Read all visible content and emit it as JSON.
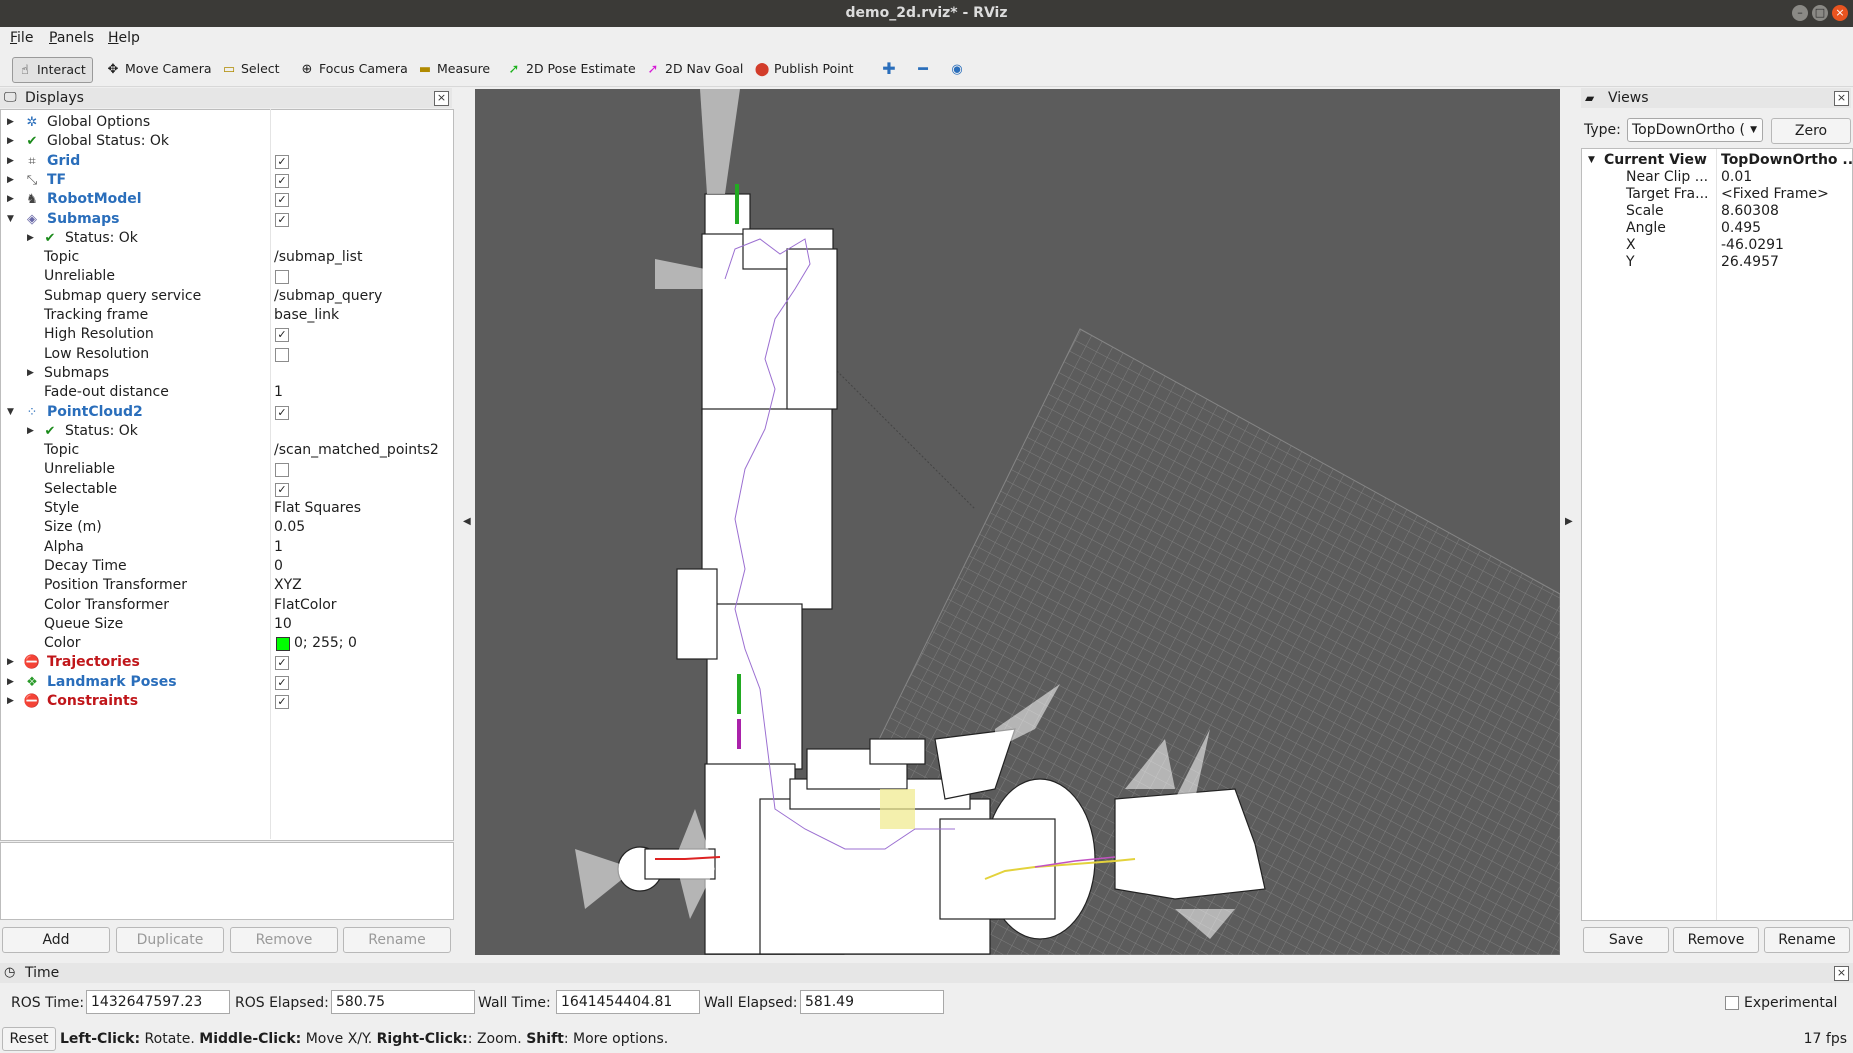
{
  "window": {
    "title": "demo_2d.rviz* - RViz"
  },
  "menu": [
    {
      "pre": "",
      "ul": "F",
      "post": "ile"
    },
    {
      "pre": "",
      "ul": "P",
      "post": "anels"
    },
    {
      "pre": "",
      "ul": "H",
      "post": "elp"
    }
  ],
  "toolbar": {
    "interact": "Interact",
    "move_camera": "Move Camera",
    "select": "Select",
    "focus_camera": "Focus Camera",
    "measure": "Measure",
    "pose_estimate": "2D Pose Estimate",
    "nav_goal": "2D Nav Goal",
    "publish_point": "Publish Point"
  },
  "displays": {
    "title": "Displays",
    "rows": [
      {
        "name": "Global Options",
        "value": ""
      },
      {
        "name": "Global Status: Ok",
        "value": ""
      },
      {
        "name": "Grid",
        "value": ""
      },
      {
        "name": "TF",
        "value": ""
      },
      {
        "name": "RobotModel",
        "value": ""
      },
      {
        "name": "Submaps",
        "value": ""
      },
      {
        "name": "Status: Ok",
        "value": ""
      },
      {
        "name": "Topic",
        "value": "/submap_list"
      },
      {
        "name": "Unreliable",
        "value": ""
      },
      {
        "name": "Submap query service",
        "value": "/submap_query"
      },
      {
        "name": "Tracking frame",
        "value": "base_link"
      },
      {
        "name": "High Resolution",
        "value": ""
      },
      {
        "name": "Low Resolution",
        "value": ""
      },
      {
        "name": "Submaps",
        "value": ""
      },
      {
        "name": "Fade-out distance",
        "value": "1"
      },
      {
        "name": "PointCloud2",
        "value": ""
      },
      {
        "name": "Status: Ok",
        "value": ""
      },
      {
        "name": "Topic",
        "value": "/scan_matched_points2"
      },
      {
        "name": "Unreliable",
        "value": ""
      },
      {
        "name": "Selectable",
        "value": ""
      },
      {
        "name": "Style",
        "value": "Flat Squares"
      },
      {
        "name": "Size (m)",
        "value": "0.05"
      },
      {
        "name": "Alpha",
        "value": "1"
      },
      {
        "name": "Decay Time",
        "value": "0"
      },
      {
        "name": "Position Transformer",
        "value": "XYZ"
      },
      {
        "name": "Color Transformer",
        "value": "FlatColor"
      },
      {
        "name": "Queue Size",
        "value": "10"
      },
      {
        "name": "Color",
        "value": "0; 255; 0"
      },
      {
        "name": "Trajectories",
        "value": ""
      },
      {
        "name": "Landmark Poses",
        "value": ""
      },
      {
        "name": "Constraints",
        "value": ""
      }
    ],
    "buttons": {
      "add": "Add",
      "duplicate": "Duplicate",
      "remove": "Remove",
      "rename": "Rename"
    }
  },
  "views": {
    "title": "Views",
    "type_label": "Type:",
    "type_value": "TopDownOrtho (",
    "zero": "Zero",
    "current_view": {
      "label": "Current View",
      "value": "TopDownOrtho ..."
    },
    "props": [
      {
        "k": "Near Clip ...",
        "v": "0.01"
      },
      {
        "k": "Target Fra...",
        "v": "<Fixed Frame>"
      },
      {
        "k": "Scale",
        "v": "8.60308"
      },
      {
        "k": "Angle",
        "v": "0.495"
      },
      {
        "k": "X",
        "v": "-46.0291"
      },
      {
        "k": "Y",
        "v": "26.4957"
      }
    ],
    "buttons": {
      "save": "Save",
      "remove": "Remove",
      "rename": "Rename"
    }
  },
  "time": {
    "title": "Time",
    "ros_time_label": "ROS Time:",
    "ros_time": "1432647597.23",
    "ros_elapsed_label": "ROS Elapsed:",
    "ros_elapsed": "580.75",
    "wall_time_label": "Wall Time:",
    "wall_time": "1641454404.81",
    "wall_elapsed_label": "Wall Elapsed:",
    "wall_elapsed": "581.49",
    "experimental": "Experimental"
  },
  "status": {
    "reset": "Reset",
    "hint_1b": "Left-Click:",
    "hint_1": " Rotate. ",
    "hint_2b": "Middle-Click:",
    "hint_2": " Move X/Y. ",
    "hint_3b": "Right-Click:",
    "hint_3": ": Zoom. ",
    "hint_4b": "Shift",
    "hint_4": ": More options.",
    "fps": "17 fps"
  },
  "colors": {
    "accent": "#e95420",
    "link_blue": "#2a6ebb",
    "error_red": "#c0161a",
    "viewport_bg": "#5c5c5c",
    "point_color": "#00ff00"
  }
}
